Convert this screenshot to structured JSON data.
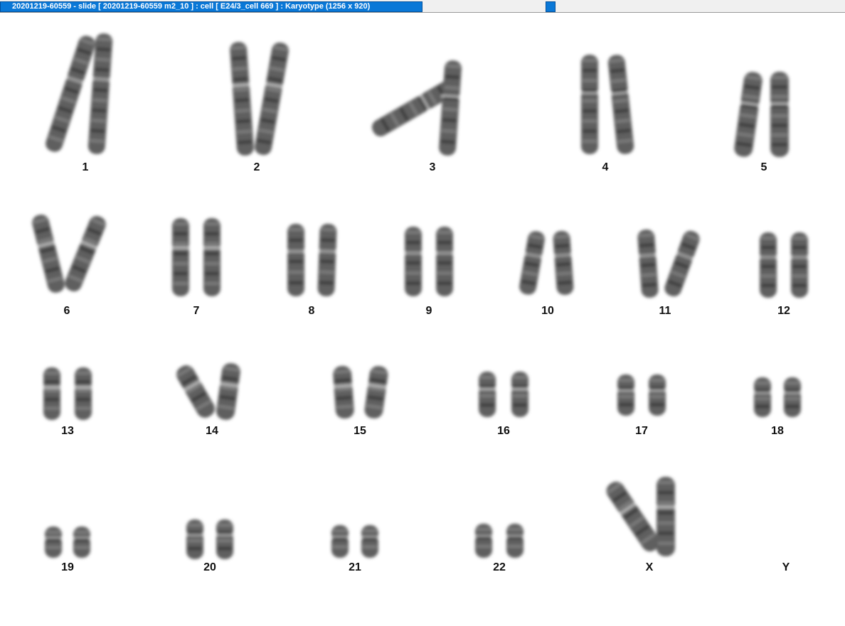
{
  "window": {
    "title": "20201219-60559 - slide [ 20201219-60559 m2_10 ] : cell [ E24/3_cell 669 ] : Karyotype  (1256 x 920)"
  },
  "colors": {
    "title_bar": "#0a78d7",
    "chromosome_fill": "#5e5e5e",
    "band_dark": "#2e2e2e",
    "label_text": "#111111"
  },
  "karyotype": {
    "labels": [
      "1",
      "2",
      "3",
      "4",
      "5",
      "6",
      "7",
      "8",
      "9",
      "10",
      "11",
      "12",
      "13",
      "14",
      "15",
      "16",
      "17",
      "18",
      "19",
      "20",
      "21",
      "22",
      "X",
      "Y"
    ]
  }
}
